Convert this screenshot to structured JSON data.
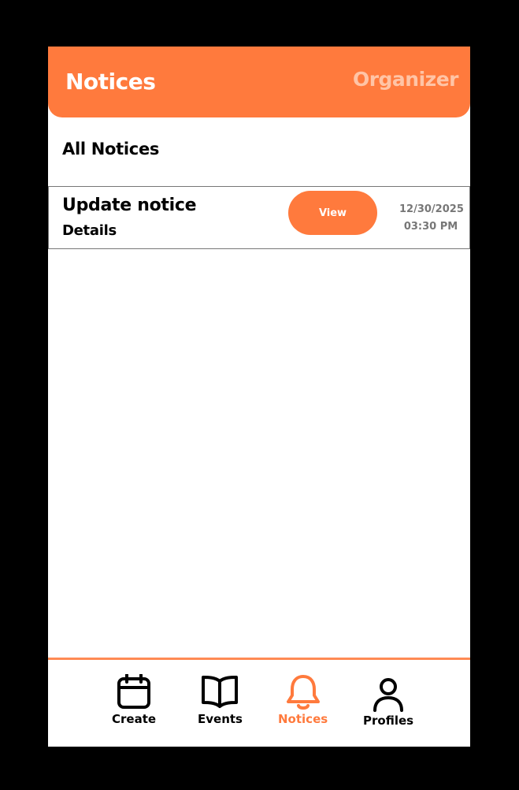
{
  "header": {
    "title": "Notices",
    "role": "Organizer"
  },
  "section": {
    "title": "All Notices"
  },
  "notices": [
    {
      "title": "Update notice",
      "subtitle": "Details",
      "button_label": "View",
      "date": "12/30/2025",
      "time": "03:30 PM"
    }
  ],
  "nav": {
    "items": [
      {
        "label": "Create",
        "icon": "calendar-icon",
        "active": false
      },
      {
        "label": "Events",
        "icon": "book-icon",
        "active": false
      },
      {
        "label": "Notices",
        "icon": "bell-icon",
        "active": true
      },
      {
        "label": "Profiles",
        "icon": "user-icon",
        "active": false
      }
    ]
  },
  "colors": {
    "accent": "#FF7A3D",
    "header_role": "#FFC4A6",
    "muted_text": "#777777",
    "background": "#000000",
    "surface": "#FFFFFF"
  }
}
